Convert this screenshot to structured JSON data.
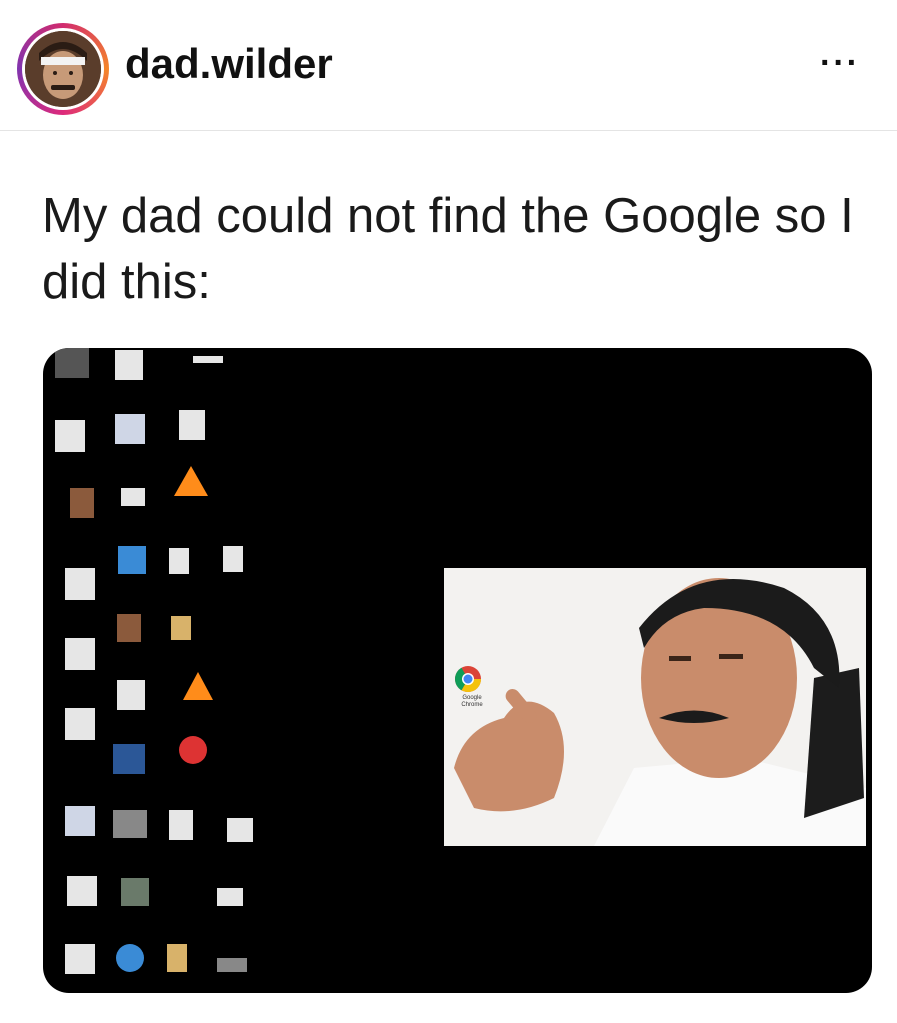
{
  "post": {
    "username": "dad.wilder",
    "more_label": "···",
    "caption": "My dad could not find the Google so I did this:"
  },
  "desktop": {
    "photo_overlay_label": "Google Chrome"
  }
}
